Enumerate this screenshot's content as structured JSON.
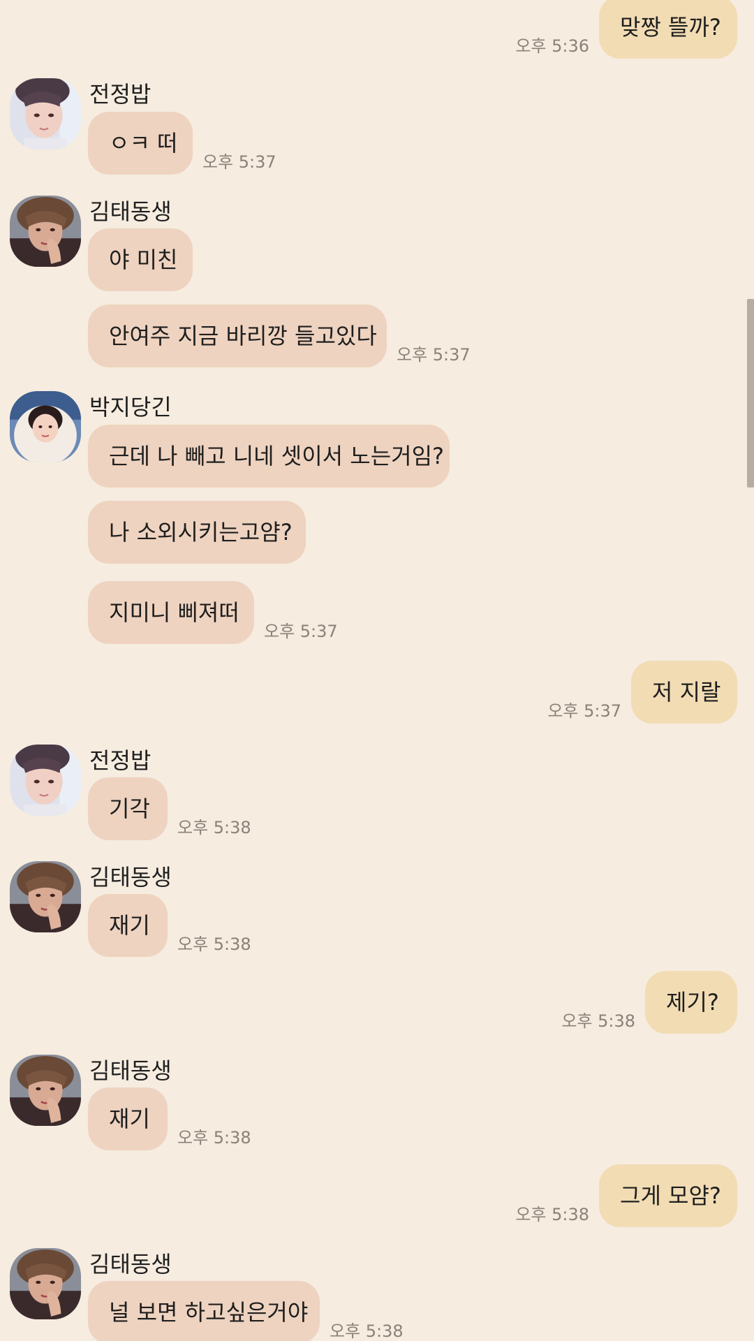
{
  "chat": {
    "messages": [
      {
        "dir": "out",
        "text": "맞짱 뜰까?",
        "time": "오후 5:36"
      },
      {
        "dir": "in",
        "sender": "전정밥",
        "avatar": "jungkook-avatar",
        "text": "ㅇㅋ 떠",
        "time": "오후 5:37"
      },
      {
        "dir": "in",
        "sender": "김태동생",
        "avatar": "taehyung-avatar",
        "text": "야 미친"
      },
      {
        "dir": "in",
        "text": "안여주 지금 바리깡 들고있다",
        "time": "오후 5:37"
      },
      {
        "dir": "in",
        "sender": "박지당긴",
        "avatar": "jimin-avatar",
        "text": "근데 나 빼고 니네 셋이서 노는거임?"
      },
      {
        "dir": "in",
        "text": "나 소외시키는고얌?"
      },
      {
        "dir": "in",
        "text": "지미니 삐져떠",
        "time": "오후 5:37"
      },
      {
        "dir": "out",
        "text": "저 지랄",
        "time": "오후 5:37"
      },
      {
        "dir": "in",
        "sender": "전정밥",
        "avatar": "jungkook-avatar",
        "text": "기각",
        "time": "오후 5:38"
      },
      {
        "dir": "in",
        "sender": "김태동생",
        "avatar": "taehyung-avatar",
        "text": "재기",
        "time": "오후 5:38"
      },
      {
        "dir": "out",
        "text": "제기?",
        "time": "오후 5:38"
      },
      {
        "dir": "in",
        "sender": "김태동생",
        "avatar": "taehyung-avatar",
        "text": "재기",
        "time": "오후 5:38"
      },
      {
        "dir": "out",
        "text": "그게 모얌?",
        "time": "오후 5:38"
      },
      {
        "dir": "in",
        "sender": "김태동생",
        "avatar": "taehyung-avatar",
        "text": "널 보면 하고싶은거야",
        "time": "오후 5:38"
      }
    ]
  },
  "colors": {
    "background": "#f6ece0",
    "incoming_bubble": "#eed3c0",
    "outgoing_bubble": "#f2dcb4",
    "timestamp": "#8b8178"
  }
}
